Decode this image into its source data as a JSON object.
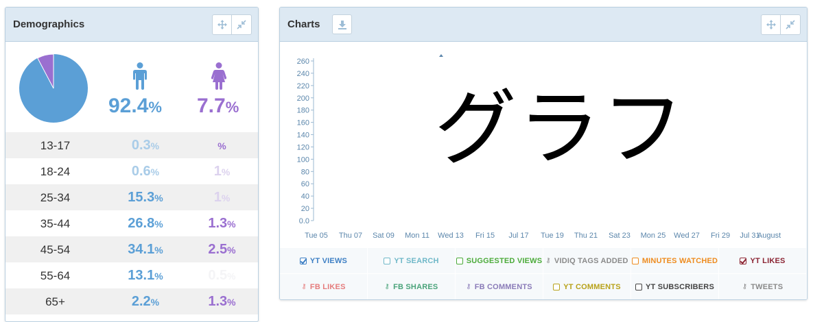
{
  "demographics": {
    "title": "Demographics",
    "male_pct": "92.4",
    "female_pct": "7.7",
    "pct_suffix": "%",
    "pie": {
      "male_fraction": 0.924,
      "female_fraction": 0.077,
      "male_color": "#5b9fd6",
      "female_color": "#9a6fd0"
    },
    "rows": [
      {
        "age": "13-17",
        "male": "0.3",
        "female": ""
      },
      {
        "age": "18-24",
        "male": "0.6",
        "female": "1"
      },
      {
        "age": "25-34",
        "male": "15.3",
        "female": "1"
      },
      {
        "age": "35-44",
        "male": "26.8",
        "female": "1.3"
      },
      {
        "age": "45-54",
        "male": "34.1",
        "female": "2.5"
      },
      {
        "age": "55-64",
        "male": "13.1",
        "female": "0.5"
      },
      {
        "age": "65+",
        "male": "2.2",
        "female": "1.3"
      }
    ]
  },
  "charts": {
    "title": "Charts",
    "watermark": "グラフ",
    "legend": [
      [
        {
          "label": "YT VIEWS",
          "checked": true,
          "color": "#3d7fc4",
          "icon": "checkbox"
        },
        {
          "label": "YT SEARCH",
          "checked": false,
          "color": "#6fb8c8",
          "icon": "checkbox"
        },
        {
          "label": "SUGGESTED VIEWS",
          "checked": false,
          "color": "#4cab3a",
          "icon": "checkbox"
        },
        {
          "label": "VIDIQ TAGS ADDED",
          "checked": false,
          "color": "#8a8a8a",
          "icon": "key"
        },
        {
          "label": "MINUTES WATCHED",
          "checked": false,
          "color": "#ee8b1e",
          "icon": "checkbox"
        },
        {
          "label": "YT LIKES",
          "checked": true,
          "color": "#8b2433",
          "icon": "checkbox"
        }
      ],
      [
        {
          "label": "FB LIKES",
          "checked": false,
          "color": "#e57c7c",
          "icon": "key"
        },
        {
          "label": "FB SHARES",
          "checked": false,
          "color": "#4aa37a",
          "icon": "key"
        },
        {
          "label": "FB COMMENTS",
          "checked": false,
          "color": "#8a7bb8",
          "icon": "key"
        },
        {
          "label": "YT COMMENTS",
          "checked": false,
          "color": "#b8a21a",
          "icon": "checkbox"
        },
        {
          "label": "YT SUBSCRIBERS",
          "checked": false,
          "color": "#444444",
          "icon": "checkbox"
        },
        {
          "label": "TWEETS",
          "checked": false,
          "color": "#8a8a8a",
          "icon": "key"
        }
      ]
    ]
  },
  "chart_data": {
    "type": "line",
    "ylim": [
      0,
      260
    ],
    "y_ticks": [
      "0.0",
      "20",
      "40",
      "60",
      "80",
      "100",
      "120",
      "140",
      "160",
      "180",
      "200",
      "220",
      "240",
      "260"
    ],
    "x_ticks": [
      "Tue 05",
      "Thu 07",
      "Sat 09",
      "Mon 11",
      "Wed 13",
      "Fri 15",
      "Jul 17",
      "Tue 19",
      "Thu 21",
      "Sat 23",
      "Mon 25",
      "Wed 27",
      "Fri 29",
      "Jul 31",
      "August"
    ],
    "series": []
  }
}
